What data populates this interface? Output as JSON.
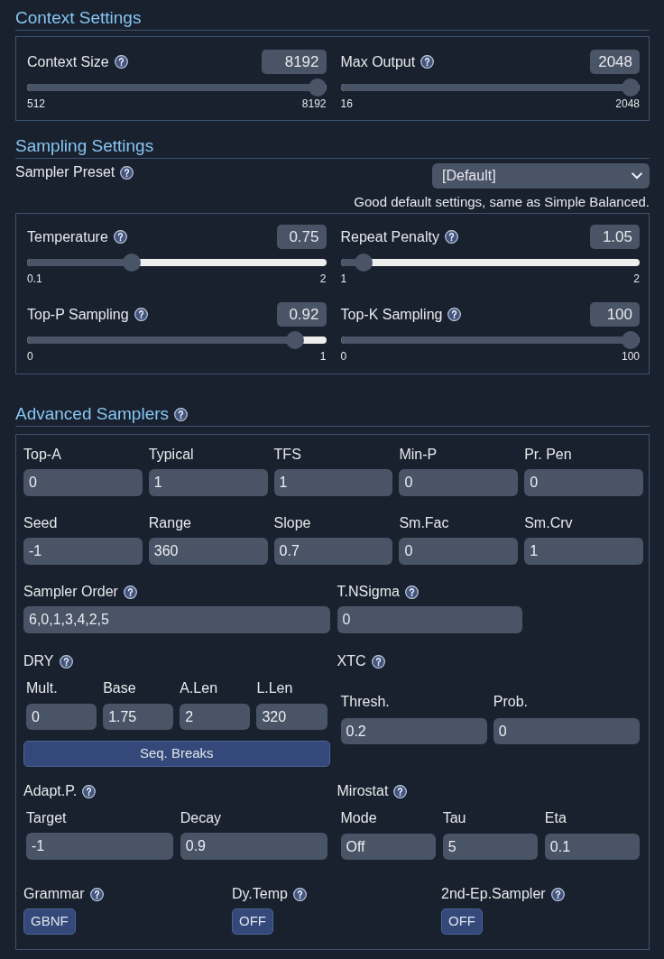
{
  "context_settings": {
    "title": "Context Settings",
    "help": false,
    "sliders": [
      {
        "label": "Context Size",
        "value": "8192",
        "min": "512",
        "max": "8192",
        "level": 1
      },
      {
        "label": "Max Output",
        "value": "2048",
        "min": "16",
        "max": "2048",
        "level": 1
      }
    ]
  },
  "sampling_settings": {
    "title": "Sampling Settings",
    "help": false,
    "preset": {
      "label": "Sampler Preset",
      "value": "[Default]",
      "description": "Good default settings, same as Simple Balanced."
    },
    "sliders": [
      {
        "label": "Temperature",
        "value": "0.75",
        "min": "0.1",
        "max": "2",
        "level": 0.34
      },
      {
        "label": "Repeat Penalty",
        "value": "1.05",
        "min": "1",
        "max": "2",
        "level": 0.05
      },
      {
        "label": "Top-P Sampling",
        "value": "0.92",
        "min": "0",
        "max": "1",
        "level": 0.92
      },
      {
        "label": "Top-K Sampling",
        "value": "100",
        "min": "0",
        "max": "100",
        "level": 1
      }
    ]
  },
  "advanced_samplers": {
    "title": "Advanced Samplers",
    "help": true,
    "field_rows": [
      [
        {
          "label": "Top-A",
          "value": "0"
        },
        {
          "label": "Typical",
          "value": "1"
        },
        {
          "label": "TFS",
          "value": "1"
        },
        {
          "label": "Min-P",
          "value": "0"
        },
        {
          "label": "Pr. Pen",
          "value": "0"
        }
      ],
      [
        {
          "label": "Seed",
          "value": "-1"
        },
        {
          "label": "Range",
          "value": "360"
        },
        {
          "label": "Slope",
          "value": "0.7"
        },
        {
          "label": "Sm.Fac",
          "value": "0"
        },
        {
          "label": "Sm.Crv",
          "value": "1"
        }
      ]
    ],
    "sampler_order": {
      "label": "Sampler Order",
      "value": "6,0,1,3,4,2,5"
    },
    "t_nsigma": {
      "label": "T.NSigma",
      "value": "0"
    },
    "dry": {
      "label": "DRY",
      "fields": [
        {
          "label": "Mult.",
          "value": "0"
        },
        {
          "label": "Base",
          "value": "1.75"
        },
        {
          "label": "A.Len",
          "value": "2"
        },
        {
          "label": "L.Len",
          "value": "320"
        }
      ],
      "button": "Seq. Breaks"
    },
    "xtc": {
      "label": "XTC",
      "fields": [
        {
          "label": "Thresh.",
          "value": "0.2"
        },
        {
          "label": "Prob.",
          "value": "0"
        }
      ]
    },
    "adaptive_p": {
      "label": "Adapt.P.",
      "fields": [
        {
          "label": "Target",
          "value": "-1"
        },
        {
          "label": "Decay",
          "value": "0.9"
        }
      ]
    },
    "mirostat": {
      "label": "Mirostat",
      "fields": [
        {
          "label": "Mode",
          "value": "Off"
        },
        {
          "label": "Tau",
          "value": "5"
        },
        {
          "label": "Eta",
          "value": "0.1"
        }
      ]
    },
    "toggles": [
      {
        "label": "Grammar",
        "button": "GBNF"
      },
      {
        "label": "Dy.Temp",
        "button": "OFF"
      },
      {
        "label": "2nd-Ep.Sampler",
        "button": "OFF"
      }
    ]
  }
}
